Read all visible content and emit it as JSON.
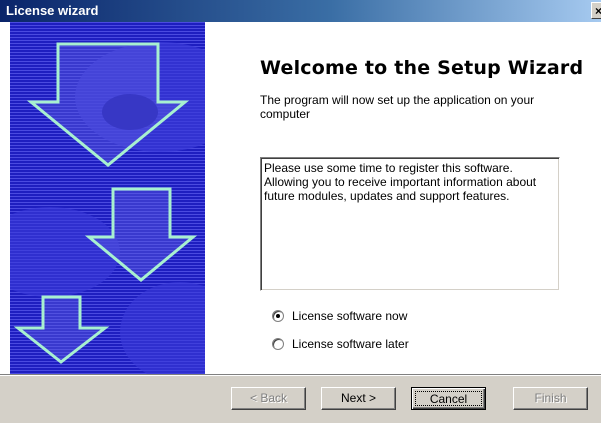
{
  "window": {
    "title": "License wizard",
    "close_label": "×"
  },
  "heading": "Welcome to the Setup Wizard",
  "intro": "The program will now set up the application on your computer",
  "message": "Please use some time to register this software.\nAllowing you to receive important information about future modules, updates and support features.",
  "options": [
    {
      "label": "License software now",
      "checked": true
    },
    {
      "label": "License software later",
      "checked": false
    }
  ],
  "buttons": {
    "back": "< Back",
    "next": "Next >",
    "cancel": "Cancel",
    "finish": "Finish"
  },
  "colors": {
    "sidebar": "#2424c8",
    "arrow_outline": "#a8f0d0",
    "titlebar": "#0a246a"
  },
  "sidebar_icons": [
    "down-arrow-icon",
    "down-arrow-icon",
    "down-arrow-icon"
  ]
}
